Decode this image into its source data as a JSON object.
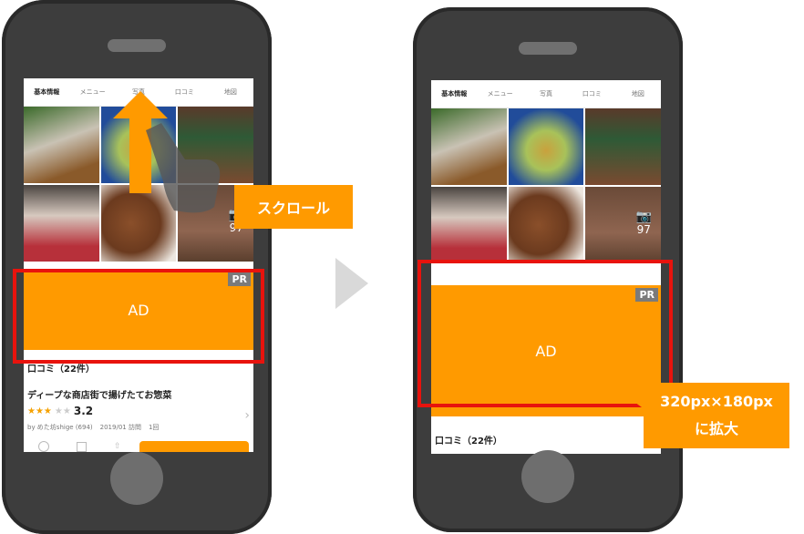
{
  "tabs": [
    "基本情報",
    "メニュー",
    "写真",
    "口コミ",
    "地図"
  ],
  "photo_count": "97",
  "ad": {
    "label": "AD",
    "badge": "PR"
  },
  "review": {
    "section_title": "口コミ（22件）",
    "headline": "ディープな商店街で揚げたてお惣菜",
    "stars": "★★★",
    "empty_stars": "★★",
    "rating": "3.2",
    "author": "by めた坊shige (694)",
    "visited": "2019/01 訪問",
    "visits": "1回"
  },
  "annotations": {
    "scroll": "スクロール",
    "size_line1": "320px×180px",
    "size_line2": "に拡大"
  },
  "colors": {
    "accent": "#ff9a00",
    "frame": "#e8130d",
    "phone_body": "#3d3d3d"
  },
  "icons": [
    "camera-icon",
    "up-arrow-icon",
    "hand-swipe-icon",
    "next-arrow-icon",
    "chevron-right-icon"
  ]
}
